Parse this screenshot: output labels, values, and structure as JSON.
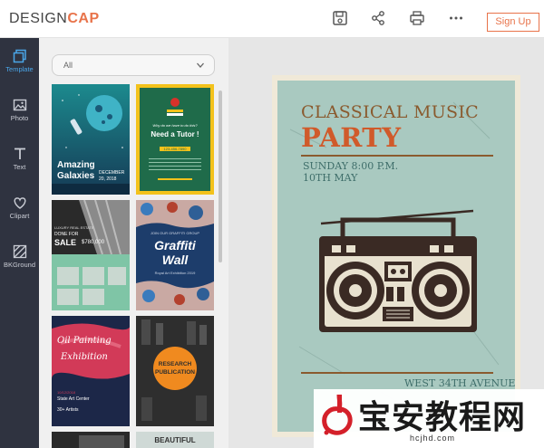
{
  "header": {
    "logo_prefix": "DESIGN",
    "logo_accent": "CAP",
    "signup_label": "Sign Up"
  },
  "sidebar": {
    "items": [
      {
        "label": "Template"
      },
      {
        "label": "Photo"
      },
      {
        "label": "Text"
      },
      {
        "label": "Clipart"
      },
      {
        "label": "BKGround"
      }
    ]
  },
  "filter": {
    "selected": "All"
  },
  "templates": {
    "t1": {
      "title_line1": "Amazing",
      "title_line2": "Galaxies",
      "date_line1": "DECEMBER",
      "date_line2": "20, 2018"
    },
    "t2": {
      "subtitle": "Why do we have to do this?",
      "title": "Need a Tutor !",
      "phone": "123-456-7890"
    },
    "t3": {
      "line1": "LUXURY REAL ESTATE",
      "line2": "DONE FOR",
      "line3": "SALE",
      "price": "$780,000"
    },
    "t4": {
      "small": "JOIN OUR GRAFFITI GROUP",
      "title_line1": "Graffiti",
      "title_line2": "Wall",
      "small2": "Royal Art Exhibition 2019"
    },
    "t5": {
      "title_line1": "Oil Painting",
      "title_line2": "Exhibition",
      "date": "10/12/2018",
      "venue": "State Art Center",
      "artists": "30+ Artists"
    },
    "t6": {
      "line1": "RESEARCH",
      "line2": "PUBLICATION"
    },
    "t8": {
      "title": "BEAUTIFUL"
    }
  },
  "poster": {
    "line1": "CLASSICAL MUSIC",
    "line2": "PARTY",
    "line3": "SUNDAY 8:00 P.M.",
    "line4": "10TH MAY",
    "address": "WEST 34TH AVENUE"
  },
  "watermark": {
    "text": "宝安教程网",
    "sub": "hcjhd.com"
  },
  "colors": {
    "accent": "#e8734a",
    "sidebar_bg": "#2f3340",
    "active_blue": "#4aa6e8",
    "poster_bg": "#a9c9c0",
    "poster_brown": "#8a5a2e",
    "poster_orange": "#d05a2a"
  }
}
